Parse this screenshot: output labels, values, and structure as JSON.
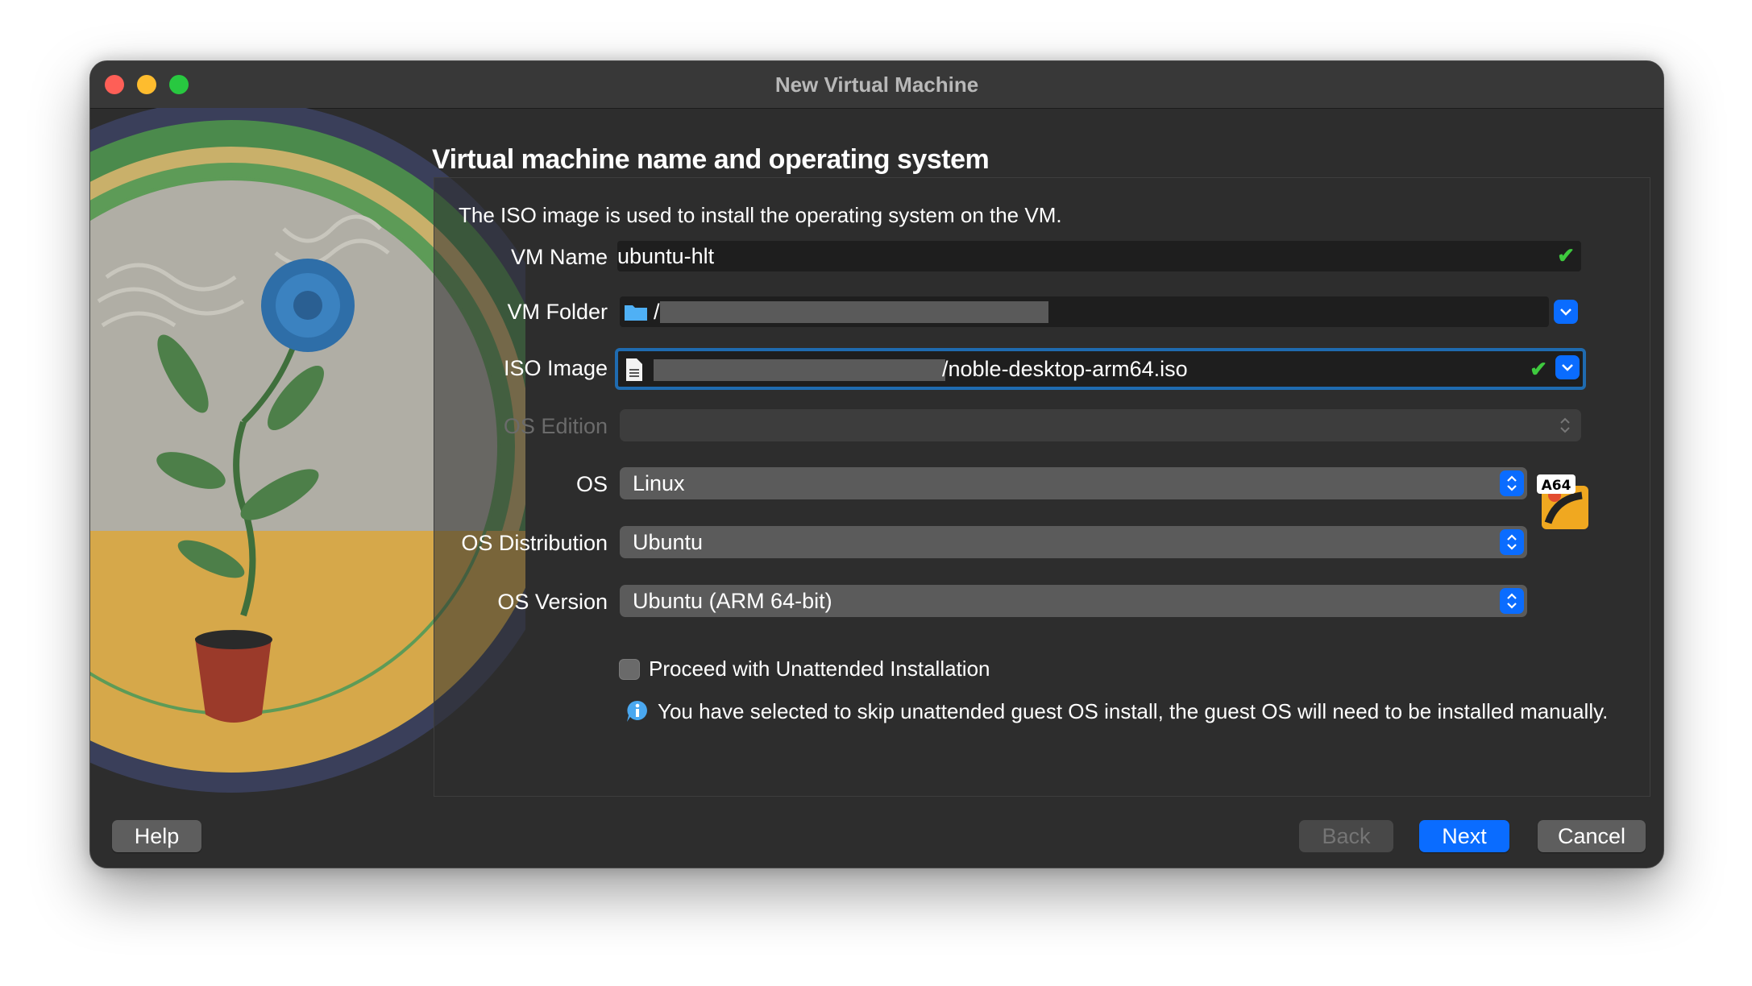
{
  "window": {
    "title": "New Virtual Machine"
  },
  "page": {
    "heading": "Virtual machine name and operating system",
    "description": "The ISO image is used to install the operating system on the VM."
  },
  "form": {
    "vm_name": {
      "label": "VM Name",
      "value": "ubuntu-hlt"
    },
    "vm_folder": {
      "label": "VM Folder",
      "value": "/"
    },
    "iso_image": {
      "label": "ISO Image",
      "value": "/noble-desktop-arm64.iso"
    },
    "os_edition": {
      "label": "OS Edition",
      "value": ""
    },
    "os": {
      "label": "OS",
      "value": "Linux",
      "badge": "A64"
    },
    "os_distribution": {
      "label": "OS Distribution",
      "value": "Ubuntu"
    },
    "os_version": {
      "label": "OS Version",
      "value": "Ubuntu (ARM 64-bit)"
    },
    "unattended": {
      "label": "Proceed with Unattended Installation",
      "checked": false
    },
    "info_message": "You have selected to skip unattended guest OS install, the guest OS will need to be installed manually."
  },
  "buttons": {
    "help": "Help",
    "back": "Back",
    "next": "Next",
    "cancel": "Cancel"
  },
  "colors": {
    "accent": "#0a6cff",
    "valid": "#3ec93e",
    "window_bg": "#2d2d2d"
  }
}
